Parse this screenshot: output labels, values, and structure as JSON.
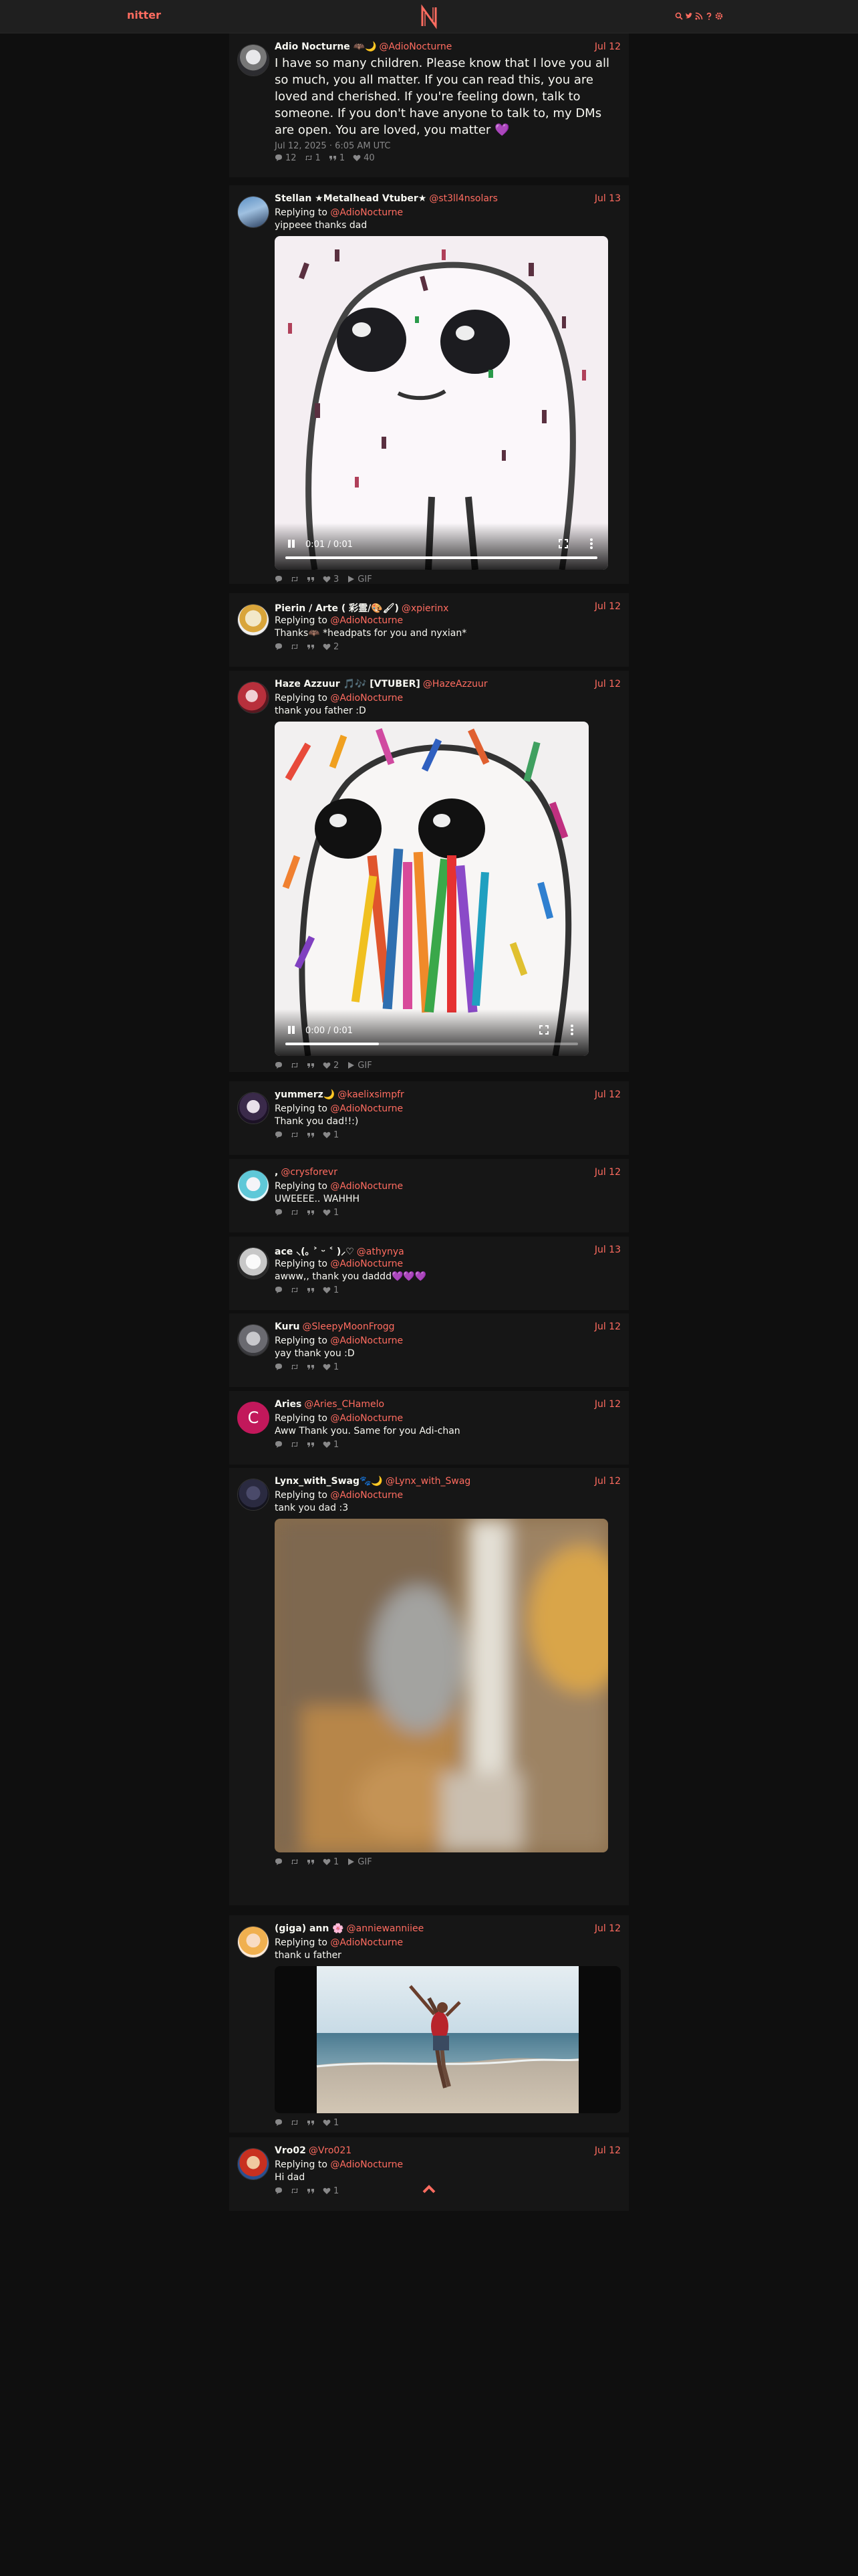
{
  "nav": {
    "logo_text": "nitter",
    "icons": [
      "search-icon",
      "twitter-icon",
      "rss-icon",
      "help-icon",
      "settings-icon"
    ]
  },
  "colors": {
    "accent": "#ff6c60",
    "background": "#0f0f0f",
    "card": "#161616",
    "muted": "#888889"
  },
  "main_tweet": {
    "fullname": "Adio Nocturne 🦇🌙",
    "username": "@AdioNocturne",
    "date": "Jul 12",
    "text": "I have so many children. Please know that I love you all so much, you all matter. If you can read this, you are loved and cherished. If you're feeling down, talk to someone. If you don't have anyone to talk to, my DMs are open. You are loved, you matter 💜",
    "published": "Jul 12, 2025 · 6:05 AM UTC",
    "stats": {
      "replies": "12",
      "retweets": "1",
      "quotes": "1",
      "likes": "40"
    }
  },
  "replies": [
    {
      "fullname": "Stellan ★Metalhead Vtuber★",
      "username": "@st3ll4nsolars",
      "date": "Jul 13",
      "replying_prefix": "Replying to",
      "replying_to": "@AdioNocturne",
      "text": "yippeee thanks dad",
      "media": {
        "kind": "video",
        "time": "0:01 / 0:01",
        "progress": 1.0
      },
      "stats": {
        "likes": "3",
        "gif": "GIF"
      }
    },
    {
      "fullname": "Pierin / Arte ( 彩霊/🎨🖌)",
      "username": "@xpierinx",
      "date": "Jul 12",
      "replying_prefix": "Replying to",
      "replying_to": "@AdioNocturne",
      "text": "Thanks🦇 *headpats for you and nyxian*",
      "stats": {
        "likes": "2"
      }
    },
    {
      "fullname": "Haze Azzuur 🎵🎶 [VTUBER]",
      "username": "@HazeAzzuur",
      "date": "Jul 12",
      "replying_prefix": "Replying to",
      "replying_to": "@AdioNocturne",
      "text": "thank you father :D",
      "media": {
        "kind": "video",
        "time": "0:00 / 0:01",
        "progress": 0.32
      },
      "stats": {
        "likes": "2",
        "gif": "GIF"
      }
    },
    {
      "fullname": "yummerz🌙",
      "username": "@kaelixsimpfr",
      "date": "Jul 12",
      "replying_prefix": "Replying to",
      "replying_to": "@AdioNocturne",
      "text": "Thank you dad!!:)",
      "stats": {
        "likes": "1"
      }
    },
    {
      "fullname": ",",
      "username": "@crysforevr",
      "date": "Jul 12",
      "replying_prefix": "Replying to",
      "replying_to": "@AdioNocturne",
      "text": "UWEEEE.. WAHHH",
      "stats": {
        "likes": "1"
      }
    },
    {
      "fullname": "ace ⸜(｡ ˃ ᵕ ˂ )⸝♡",
      "username": "@athynya",
      "date": "Jul 13",
      "replying_prefix": "Replying to",
      "replying_to": "@AdioNocturne",
      "text": "awww,, thank you daddd💜💜💜",
      "stats": {
        "likes": "1"
      }
    },
    {
      "fullname": "Kuru",
      "username": "@SleepyMoonFrogg",
      "date": "Jul 12",
      "replying_prefix": "Replying to",
      "replying_to": "@AdioNocturne",
      "text": "yay thank you :D",
      "stats": {
        "likes": "1"
      }
    },
    {
      "fullname": "Aries",
      "username": "@Aries_CHamelo",
      "date": "Jul 12",
      "replying_prefix": "Replying to",
      "replying_to": "@AdioNocturne",
      "text": "Aww Thank you. Same for you Adi-chan",
      "avatar_letter": "C",
      "stats": {
        "likes": "1"
      }
    },
    {
      "fullname": "Lynx_with_Swag🐾🌙",
      "username": "@Lynx_with_Swag",
      "date": "Jul 12",
      "replying_prefix": "Replying to",
      "replying_to": "@AdioNocturne",
      "text": "tank you dad :3",
      "media": {
        "kind": "gif"
      },
      "stats": {
        "likes": "1",
        "gif": "GIF"
      }
    },
    {
      "fullname": "(giga) ann 🌸",
      "username": "@anniewanniiee",
      "date": "Jul 12",
      "replying_prefix": "Replying to",
      "replying_to": "@AdioNocturne",
      "text": "thank u father",
      "media": {
        "kind": "photo"
      },
      "stats": {
        "likes": "1"
      }
    },
    {
      "fullname": "Vro02",
      "username": "@Vro021",
      "date": "Jul 12",
      "replying_prefix": "Replying to",
      "replying_to": "@AdioNocturne",
      "text": "Hi dad",
      "stats": {
        "likes": "1"
      }
    }
  ]
}
